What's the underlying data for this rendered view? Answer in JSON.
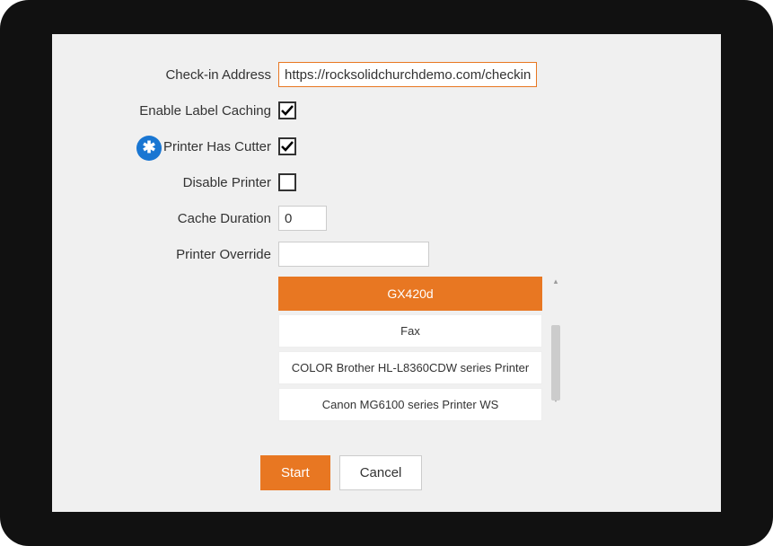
{
  "form": {
    "checkin_address_label": "Check-in Address",
    "checkin_address_value": "https://rocksolidchurchdemo.com/checkin",
    "enable_label_caching_label": "Enable Label Caching",
    "enable_label_caching_checked": true,
    "printer_has_cutter_label": "Printer Has Cutter",
    "printer_has_cutter_checked": true,
    "disable_printer_label": "Disable Printer",
    "disable_printer_checked": false,
    "cache_duration_label": "Cache Duration",
    "cache_duration_value": "0",
    "printer_override_label": "Printer Override",
    "printer_override_value": ""
  },
  "badge_symbol": "✱",
  "printer_list": {
    "items": [
      {
        "name": "GX420d",
        "selected": true
      },
      {
        "name": "Fax",
        "selected": false
      },
      {
        "name": "COLOR Brother HL-L8360CDW series Printer",
        "selected": false
      },
      {
        "name": "Canon MG6100 series Printer WS",
        "selected": false
      }
    ]
  },
  "buttons": {
    "start": "Start",
    "cancel": "Cancel"
  }
}
